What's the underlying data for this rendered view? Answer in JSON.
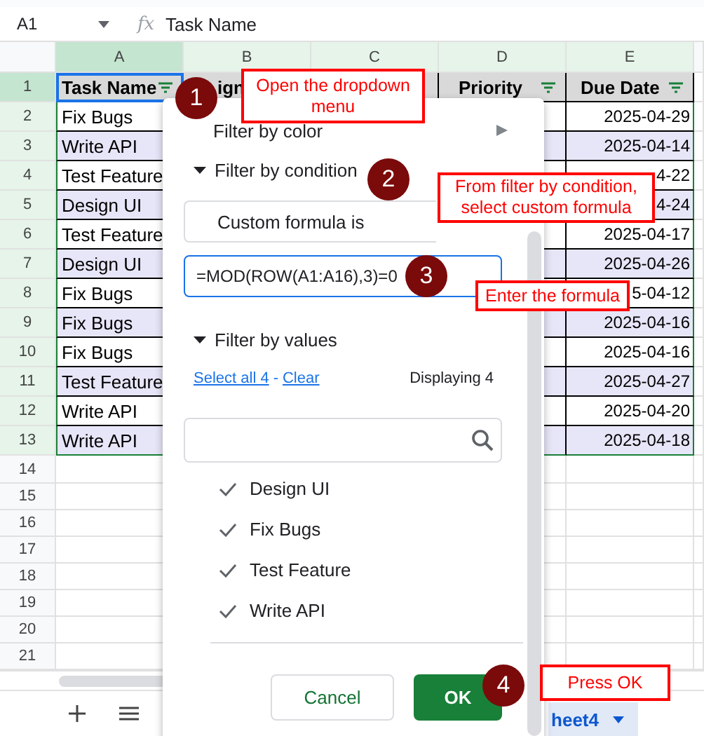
{
  "formula_bar": {
    "cell_ref": "A1",
    "fx": "fx",
    "formula": "Task Name"
  },
  "column_letters": [
    {
      "letter": "A",
      "selected": true
    },
    {
      "letter": "B",
      "selected": false
    },
    {
      "letter": "C",
      "selected": false
    },
    {
      "letter": "D",
      "selected": false
    },
    {
      "letter": "E",
      "selected": false
    }
  ],
  "header_row": {
    "number": "1",
    "selected": true,
    "task": "Task Name",
    "assigned": "ign",
    "priority": "Priority",
    "due_date": "Due Date"
  },
  "rows": [
    {
      "number": "2",
      "selected": false,
      "task": "Fix Bugs",
      "due_date": "2025-04-29"
    },
    {
      "number": "3",
      "selected": false,
      "task": "Write API",
      "due_date": "2025-04-14"
    },
    {
      "number": "4",
      "selected": false,
      "task": "Test Feature",
      "due_date": "4-22"
    },
    {
      "number": "5",
      "selected": false,
      "task": "Design UI",
      "due_date": "4-24"
    },
    {
      "number": "6",
      "selected": false,
      "task": "Test Feature",
      "due_date": "2025-04-17"
    },
    {
      "number": "7",
      "selected": false,
      "task": "Design UI",
      "due_date": "2025-04-26"
    },
    {
      "number": "8",
      "selected": false,
      "task": "Fix Bugs",
      "due_date": "5-04-12"
    },
    {
      "number": "9",
      "selected": false,
      "task": "Fix Bugs",
      "due_date": "2025-04-16"
    },
    {
      "number": "10",
      "selected": false,
      "task": "Fix Bugs",
      "due_date": "2025-04-16"
    },
    {
      "number": "11",
      "selected": false,
      "task": "Test Feature",
      "due_date": "2025-04-27"
    },
    {
      "number": "12",
      "selected": false,
      "task": "Write API",
      "due_date": "2025-04-20"
    },
    {
      "number": "13",
      "selected": false,
      "task": "Write API",
      "due_date": "2025-04-18"
    }
  ],
  "empty_row_numbers": [
    "14",
    "15",
    "16",
    "17",
    "18",
    "19",
    "20",
    "21"
  ],
  "filter_menu": {
    "filter_by_color": "Filter by color",
    "condition_section": {
      "label": "Filter by condition",
      "expanded": true,
      "condition": "Custom formula is",
      "formula": "=MOD(ROW(A1:A16),3)=0"
    },
    "values_section": {
      "label": "Filter by values",
      "expanded": true,
      "select_all": "Select all 4",
      "separator": "-",
      "clear": "Clear",
      "count": "Displaying 4",
      "values": [
        {
          "label": "Design UI",
          "checked": true
        },
        {
          "label": "Fix Bugs",
          "checked": true
        },
        {
          "label": "Test Feature",
          "checked": true
        },
        {
          "label": "Write API",
          "checked": true
        }
      ]
    },
    "cancel_button": "Cancel",
    "ok_button": "OK"
  },
  "sheet_tab": {
    "label": "heet4",
    "selected": true
  },
  "callouts": [
    {
      "number": "1",
      "text": "Open the dropdown menu"
    },
    {
      "number": "2",
      "text": "From filter by condition, select custom formula"
    },
    {
      "number": "3",
      "text": "Enter the formula"
    },
    {
      "number": "4",
      "text": "Press OK"
    }
  ]
}
